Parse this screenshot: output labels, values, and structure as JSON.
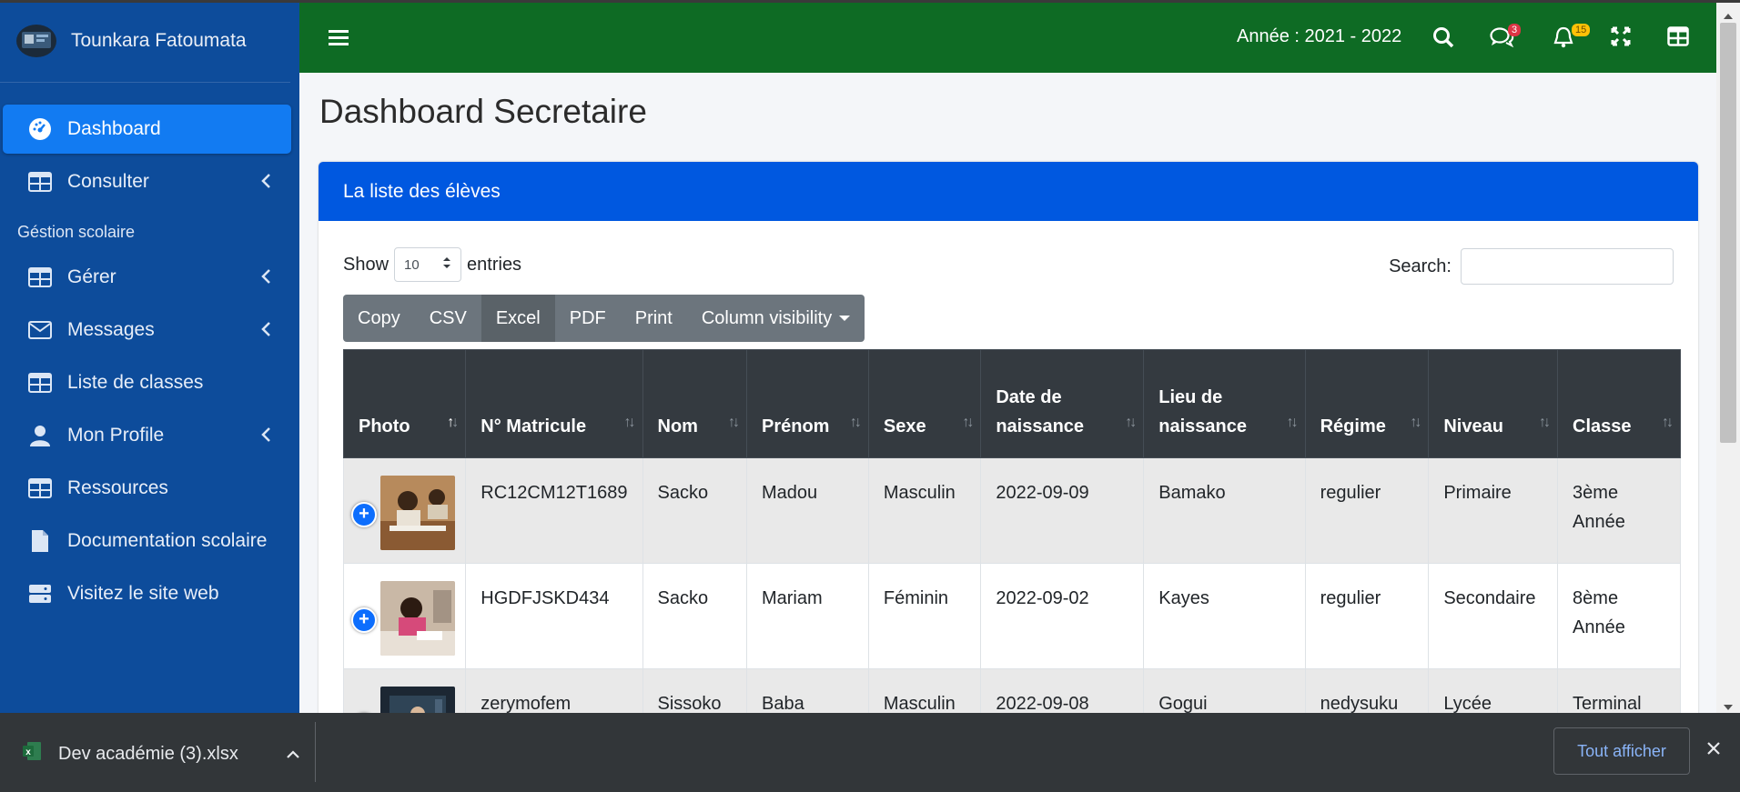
{
  "user": {
    "name": "Tounkara Fatoumata"
  },
  "sidebar": {
    "items": [
      {
        "label": "Dashboard",
        "icon": "gauge-icon",
        "active": true
      },
      {
        "label": "Consulter",
        "icon": "table-icon"
      }
    ],
    "section_header": "Géstion scolaire",
    "section_items": [
      {
        "label": "Gérer",
        "icon": "table-icon"
      },
      {
        "label": "Messages",
        "icon": "envelope-icon"
      },
      {
        "label": "Liste de classes",
        "icon": "table-icon"
      },
      {
        "label": "Mon Profile",
        "icon": "user-icon"
      },
      {
        "label": "Ressources",
        "icon": "table-icon"
      },
      {
        "label": "Documentation scolaire",
        "icon": "file-icon"
      },
      {
        "label": "Visitez le site web",
        "icon": "server-icon"
      }
    ]
  },
  "topbar": {
    "year": "Année : 2021 - 2022",
    "messages_count": "3",
    "notifications_count": "15",
    "colors": {
      "bar": "#0e6b24"
    }
  },
  "page": {
    "title": "Dashboard Secretaire"
  },
  "card": {
    "title": "La liste des élèves",
    "show_label": "Show",
    "entries_value": "10",
    "entries_label": "entries",
    "search_label": "Search:",
    "buttons": [
      "Copy",
      "CSV",
      "Excel",
      "PDF",
      "Print",
      "Column visibility"
    ]
  },
  "table": {
    "headers": [
      "Photo",
      "N° Matricule",
      "Nom",
      "Prénom",
      "Sexe",
      "Date de naissance",
      "Lieu de naissance",
      "Régime",
      "Niveau",
      "Classe"
    ],
    "rows": [
      [
        "RC12CM12T1689",
        "Sacko",
        "Madou",
        "Masculin",
        "2022-09-09",
        "Bamako",
        "regulier",
        "Primaire",
        "3ème Année"
      ],
      [
        "HGDFJSKD434",
        "Sacko",
        "Mariam",
        "Féminin",
        "2022-09-02",
        "Kayes",
        "regulier",
        "Secondaire",
        "8ème Année"
      ],
      [
        "zerymofem",
        "Sissoko",
        "Baba",
        "Masculin",
        "2022-09-08",
        "Gogui",
        "nedysuku",
        "Lycée",
        "Terminal"
      ]
    ]
  },
  "download": {
    "file": "Dev académie (3).xlsx",
    "show_all": "Tout afficher"
  }
}
